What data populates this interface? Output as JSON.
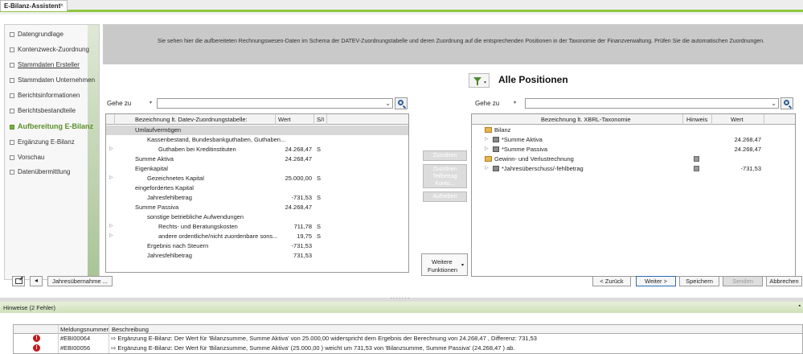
{
  "window": {
    "tab_title": "E-Bilanz-Assistent",
    "close_glyph": "×"
  },
  "sidebar": {
    "items": [
      {
        "label": "Datengrundlage",
        "state": "normal"
      },
      {
        "label": "Kontenzweck-Zuordnung",
        "state": "normal"
      },
      {
        "label": "Stammdaten Ersteller",
        "state": "underline"
      },
      {
        "label": "Stammdaten Unternehmen",
        "state": "normal"
      },
      {
        "label": "Berichtsinformationen",
        "state": "normal"
      },
      {
        "label": "Berichtsbestandteile",
        "state": "normal"
      },
      {
        "label": "Aufbereitung E-Bilanz",
        "state": "active"
      },
      {
        "label": "Ergänzung E-Bilanz",
        "state": "normal"
      },
      {
        "label": "Vorschau",
        "state": "normal"
      },
      {
        "label": "Datenübermittlung",
        "state": "normal"
      }
    ]
  },
  "banner": {
    "text": "Sie sehen hier die aufbereiteten Rechnungswesen-Daten im Schema der DATEV-Zuordnungstabelle und deren Zuordnung auf die entsprechenden Positionen in der Taxonomie der Finanzverwaltung. Prüfen Sie die automatischen Zuordnungen."
  },
  "left_panel": {
    "gehe_zu_label": "Gehe zu",
    "search_value": "",
    "columns": {
      "name": "Bezeichnung lt. Datev-Zuordnungstabelle:",
      "value": "Wert",
      "sh": "S/I"
    },
    "rows": [
      {
        "name": "Umlaufvermögen",
        "value": "",
        "sh": "",
        "grey": true,
        "expander": false,
        "indent": 0
      },
      {
        "name": "Kassenbestand,  Bundesbankguthaben,  Guthaben...",
        "value": "",
        "sh": "",
        "grey": false,
        "expander": false,
        "indent": 1
      },
      {
        "name": "Guthaben bei Kreditinstituten",
        "value": "24.268,47",
        "sh": "S",
        "grey": false,
        "expander": true,
        "indent": 2
      },
      {
        "name": "Summe Aktiva",
        "value": "24.268,47",
        "sh": "",
        "grey": false,
        "expander": false,
        "indent": 0
      },
      {
        "name": "Eigenkapital",
        "value": "",
        "sh": "",
        "grey": false,
        "expander": false,
        "indent": 0
      },
      {
        "name": "Gezeichnetes Kapital",
        "value": "25.000,00",
        "sh": "S",
        "grey": false,
        "expander": true,
        "indent": 1
      },
      {
        "name": "eingefordertes Kapital",
        "value": "",
        "sh": "",
        "grey": false,
        "expander": false,
        "indent": 0
      },
      {
        "name": "Jahresfehlbetrag",
        "value": "-731,53",
        "sh": "S",
        "grey": false,
        "expander": false,
        "indent": 1
      },
      {
        "name": "Summe Passiva",
        "value": "24.268,47",
        "sh": "",
        "grey": false,
        "expander": false,
        "indent": 0
      },
      {
        "name": "sonstige betriebliche Aufwendungen",
        "value": "",
        "sh": "",
        "grey": false,
        "expander": false,
        "indent": 1
      },
      {
        "name": "Rechts- und Beratungskosten",
        "value": "711,78",
        "sh": "S",
        "grey": false,
        "expander": true,
        "indent": 2
      },
      {
        "name": "andere ordentliche/nicht zuordenbare sons...",
        "value": "19,75",
        "sh": "S",
        "grey": false,
        "expander": true,
        "indent": 2
      },
      {
        "name": "Ergebnis nach Steuern",
        "value": "-731,53",
        "sh": "",
        "grey": false,
        "expander": false,
        "indent": 1
      },
      {
        "name": "Jahresfehlbetrag",
        "value": "731,53",
        "sh": "",
        "grey": false,
        "expander": false,
        "indent": 1
      }
    ]
  },
  "middle": {
    "zuordnen": "Zuordnen",
    "zuordnen_teil_1": "Zuordnen",
    "zuordnen_teil_2": "Teilbetrag",
    "zuordnen_teil_3": "Konto...",
    "aufheben": "Aufheben",
    "weitere_1": "Weitere",
    "weitere_2": "Funktionen"
  },
  "right_panel": {
    "title": "Alle Positionen",
    "gehe_zu_label": "Gehe zu",
    "search_value": "",
    "columns": {
      "name": "Bezeichnung lt. XBRL-Taxonomie",
      "hint": "Hinweis",
      "value": "Wert"
    },
    "rows": [
      {
        "name": "Bilanz",
        "value": "",
        "kind": "folder",
        "expander": false,
        "hint": false
      },
      {
        "name": "*Summe Aktiva",
        "value": "24.268,47",
        "kind": "account",
        "expander": true,
        "hint": false
      },
      {
        "name": "*Summe Passiva",
        "value": "24.268,47",
        "kind": "account",
        "expander": true,
        "hint": false
      },
      {
        "name": "Gewinn- und Verlustrechnung",
        "value": "",
        "kind": "folder",
        "expander": false,
        "hint": true
      },
      {
        "name": "*Jahresüberschuss/-fehlbetrag",
        "value": "-731,53",
        "kind": "account",
        "expander": true,
        "hint": true
      }
    ]
  },
  "footer": {
    "jahresuebernahme": "Jahresübernahme ...",
    "zurueck": "< Zurück",
    "weiter": "Weiter >",
    "speichern": "Speichern",
    "senden": "Senden",
    "abbrechen": "Abbrechen"
  },
  "hints": {
    "title": "Hinweise (2 Fehler)",
    "columns": {
      "code": "Meldungsnummer",
      "desc": "Beschreibung"
    },
    "rows": [
      {
        "code": "#EBI00064",
        "desc": "⇨ Ergänzung E-Bilanz: Der Wert für 'Bilanzsumme, Summe Aktiva' von 25.000,00  widerspricht dem Ergebnis der Berechnung von 24.268,47 , Differenz: 731,53"
      },
      {
        "code": "#EBI00056",
        "desc": "⇨ Ergänzung E-Bilanz: Der Wert für 'Bilanzsumme, Summe Aktiva' (25.000,00 ) weicht um 731,53  von 'Bilanzsumme, Summe Passiva' (24.268,47 ) ab."
      }
    ]
  },
  "colors": {
    "accent_green": "#8dc63f",
    "active_nav": "#5b8f2a",
    "error_red": "#c41a1a",
    "primary_blue": "#2b6cb3"
  }
}
